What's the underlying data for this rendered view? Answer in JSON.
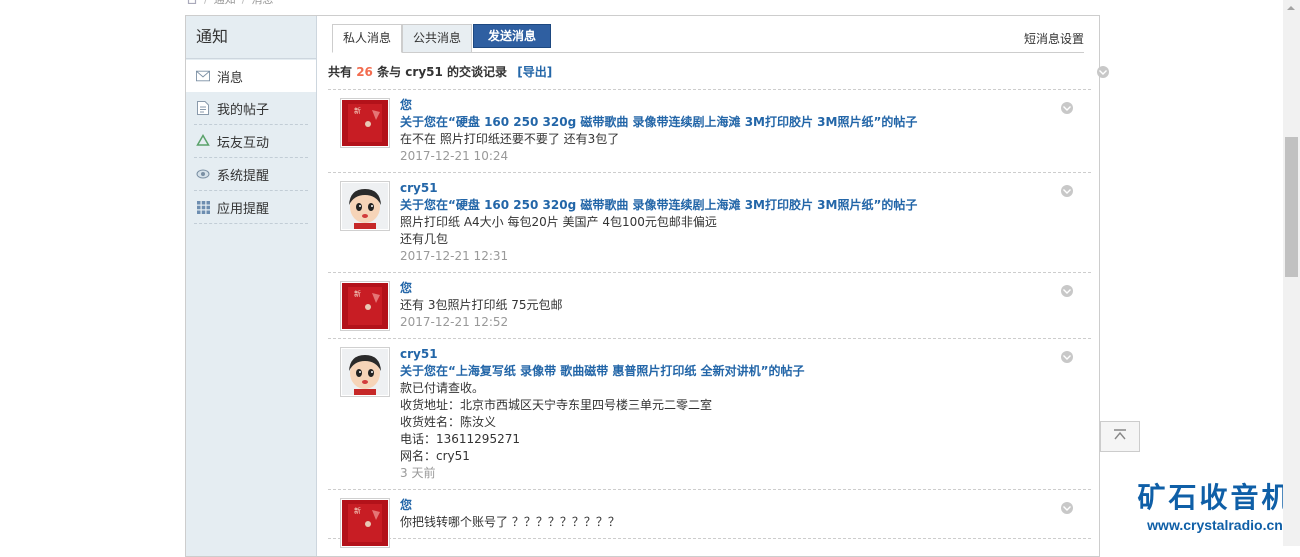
{
  "breadcrumb": {
    "items": [
      "通知",
      "消息"
    ]
  },
  "sidebar": {
    "title": "通知",
    "items": [
      {
        "label": "消息",
        "icon": "envelope-icon",
        "active": true
      },
      {
        "label": "我的帖子",
        "icon": "document-icon"
      },
      {
        "label": "坛友互动",
        "icon": "recycle-icon"
      },
      {
        "label": "系统提醒",
        "icon": "bell-icon"
      },
      {
        "label": "应用提醒",
        "icon": "grid-icon"
      }
    ]
  },
  "tabs": {
    "private": "私人消息",
    "public": "公共消息",
    "send": "发送消息",
    "settings": "短消息设置"
  },
  "summary": {
    "prefix": "共有",
    "count": "26",
    "middle": "条与",
    "user": "cry51",
    "suffix": "的交谈记录",
    "export": "[导出]"
  },
  "messages": [
    {
      "author": "您",
      "avatar": "red-card",
      "lines": [
        "关于您在“硬盘 160 250 320g 磁带歌曲 录像带连续剧上海滩 3M打印胶片 3M照片纸”的帖子",
        "在不在 照片打印纸还要不要了 还有3包了"
      ],
      "time": "2017-12-21 10:24"
    },
    {
      "author": "cry51",
      "avatar": "cartoon-face",
      "lines": [
        "关于您在“硬盘 160 250 320g 磁带歌曲 录像带连续剧上海滩 3M打印胶片 3M照片纸”的帖子",
        "照片打印纸 A4大小 每包20片 美国产 4包100元包邮非偏远",
        "还有几包"
      ],
      "time": "2017-12-21 12:31"
    },
    {
      "author": "您",
      "avatar": "red-card",
      "lines": [
        "还有 3包照片打印纸 75元包邮"
      ],
      "time": "2017-12-21 12:52"
    },
    {
      "author": "cry51",
      "avatar": "cartoon-face",
      "lines": [
        "关于您在“上海复写纸 录像带 歌曲磁带 惠普照片打印纸 全新对讲机”的帖子",
        "款已付请查收。",
        "收货地址：北京市西城区天宁寺东里四号楼三单元二零二室",
        "收货姓名：陈汝义",
        "电话：13611295271",
        "网名：cry51"
      ],
      "time": "3 天前"
    },
    {
      "author": "您",
      "avatar": "red-card",
      "lines": [
        "你把钱转哪个账号了 ？？？？？？？？？"
      ],
      "time": ""
    }
  ],
  "watermark": {
    "title": "矿石收音机",
    "url": "www.crystalradio.cn"
  },
  "colors": {
    "link": "#2366a8",
    "accent": "#f26c4f",
    "send_button": "#2f5fa1",
    "sidebar_bg": "#e5edf2",
    "watermark": "#0f5fa7"
  }
}
